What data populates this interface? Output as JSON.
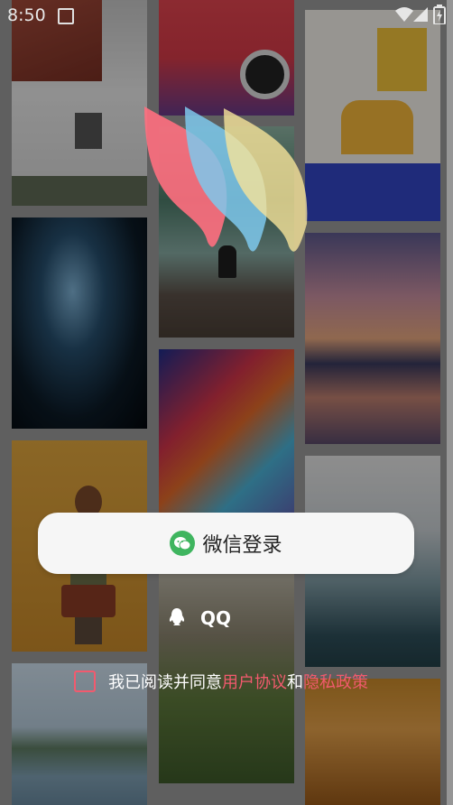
{
  "status_bar": {
    "time": "8:50",
    "icons": [
      "notification-icon",
      "wifi-icon",
      "signal-icon",
      "battery-icon"
    ]
  },
  "login": {
    "wechat_label": "微信登录",
    "qq_label": "QQ"
  },
  "agreement": {
    "prefix": "我已阅读并同意",
    "user_agreement": "用户协议",
    "and": "和",
    "privacy_policy": "隐私政策"
  },
  "colors": {
    "accent": "#f25a6e",
    "wechat_green": "#3fb55f",
    "button_bg": "#f6f6f6"
  }
}
